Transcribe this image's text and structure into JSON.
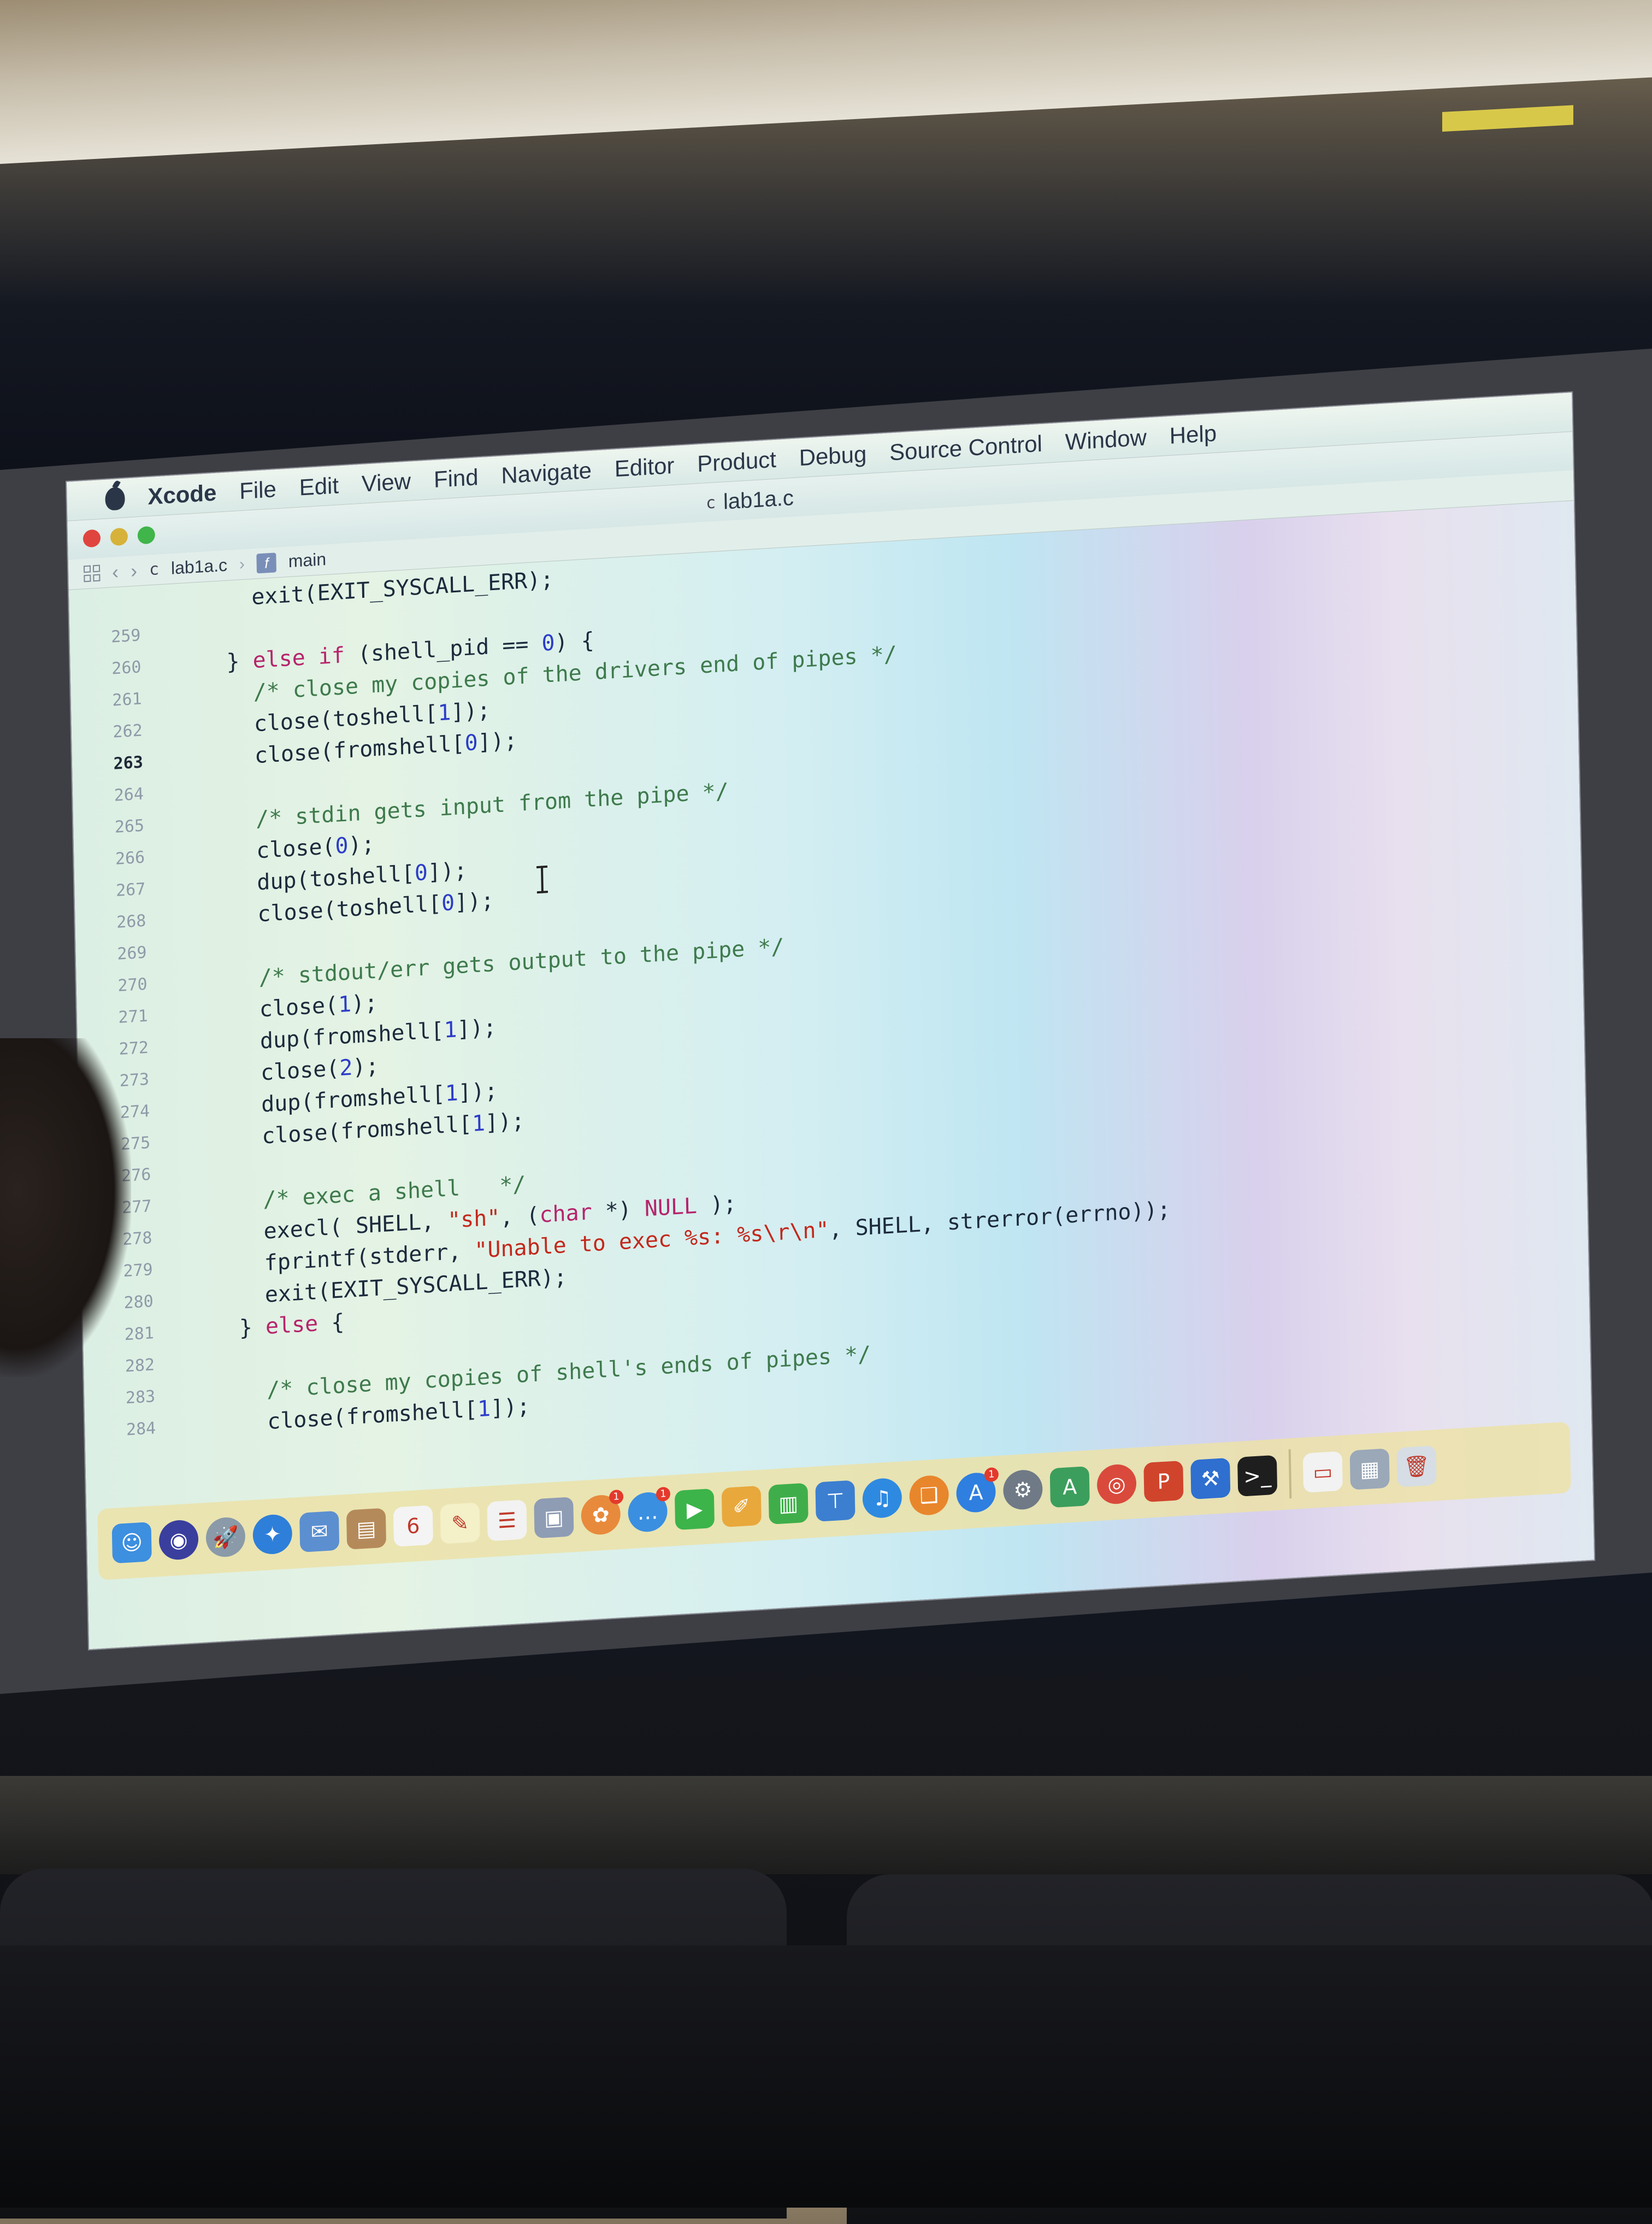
{
  "menubar": {
    "app_name": "Xcode",
    "items": [
      "File",
      "Edit",
      "View",
      "Find",
      "Navigate",
      "Editor",
      "Product",
      "Debug",
      "Source Control",
      "Window",
      "Help"
    ]
  },
  "window": {
    "title": "lab1a.c"
  },
  "jumpbar": {
    "file": "lab1a.c",
    "symbol": "main",
    "symbol_icon_letter": "f"
  },
  "editor": {
    "current_line": "263",
    "lines": [
      {
        "n": "",
        "parts": [
          {
            "t": "      exit(EXIT_SYSCALL_ERR);",
            "c": ""
          }
        ]
      },
      {
        "n": "259",
        "parts": []
      },
      {
        "n": "260",
        "parts": [
          {
            "t": "    } ",
            "c": ""
          },
          {
            "t": "else if",
            "c": "kw"
          },
          {
            "t": " (shell_pid == ",
            "c": ""
          },
          {
            "t": "0",
            "c": "num"
          },
          {
            "t": ") {",
            "c": ""
          }
        ]
      },
      {
        "n": "261",
        "parts": [
          {
            "t": "      ",
            "c": ""
          },
          {
            "t": "/* close my copies of the drivers end of pipes */",
            "c": "cm"
          }
        ]
      },
      {
        "n": "262",
        "parts": [
          {
            "t": "      close(toshell[",
            "c": ""
          },
          {
            "t": "1",
            "c": "num"
          },
          {
            "t": "]);",
            "c": ""
          }
        ]
      },
      {
        "n": "263",
        "parts": [
          {
            "t": "      close(fromshell[",
            "c": ""
          },
          {
            "t": "0",
            "c": "num"
          },
          {
            "t": "]);",
            "c": ""
          }
        ]
      },
      {
        "n": "264",
        "parts": []
      },
      {
        "n": "265",
        "parts": [
          {
            "t": "      ",
            "c": ""
          },
          {
            "t": "/* stdin gets input from the pipe */",
            "c": "cm"
          }
        ]
      },
      {
        "n": "266",
        "parts": [
          {
            "t": "      close(",
            "c": ""
          },
          {
            "t": "0",
            "c": "num"
          },
          {
            "t": ");",
            "c": ""
          }
        ]
      },
      {
        "n": "267",
        "parts": [
          {
            "t": "      dup(toshell[",
            "c": ""
          },
          {
            "t": "0",
            "c": "num"
          },
          {
            "t": "]);",
            "c": ""
          }
        ]
      },
      {
        "n": "268",
        "parts": [
          {
            "t": "      close(toshell[",
            "c": ""
          },
          {
            "t": "0",
            "c": "num"
          },
          {
            "t": "]);",
            "c": ""
          }
        ]
      },
      {
        "n": "269",
        "parts": []
      },
      {
        "n": "270",
        "parts": [
          {
            "t": "      ",
            "c": ""
          },
          {
            "t": "/* stdout/err gets output to the pipe */",
            "c": "cm"
          }
        ]
      },
      {
        "n": "271",
        "parts": [
          {
            "t": "      close(",
            "c": ""
          },
          {
            "t": "1",
            "c": "num"
          },
          {
            "t": ");",
            "c": ""
          }
        ]
      },
      {
        "n": "272",
        "parts": [
          {
            "t": "      dup(fromshell[",
            "c": ""
          },
          {
            "t": "1",
            "c": "num"
          },
          {
            "t": "]);",
            "c": ""
          }
        ]
      },
      {
        "n": "273",
        "parts": [
          {
            "t": "      close(",
            "c": ""
          },
          {
            "t": "2",
            "c": "num"
          },
          {
            "t": ");",
            "c": ""
          }
        ]
      },
      {
        "n": "274",
        "parts": [
          {
            "t": "      dup(fromshell[",
            "c": ""
          },
          {
            "t": "1",
            "c": "num"
          },
          {
            "t": "]);",
            "c": ""
          }
        ]
      },
      {
        "n": "275",
        "parts": [
          {
            "t": "      close(fromshell[",
            "c": ""
          },
          {
            "t": "1",
            "c": "num"
          },
          {
            "t": "]);",
            "c": ""
          }
        ]
      },
      {
        "n": "276",
        "parts": []
      },
      {
        "n": "277",
        "parts": [
          {
            "t": "      ",
            "c": ""
          },
          {
            "t": "/* exec a shell   */",
            "c": "cm"
          }
        ]
      },
      {
        "n": "278",
        "parts": [
          {
            "t": "      execl( SHELL, ",
            "c": ""
          },
          {
            "t": "\"sh\"",
            "c": "str"
          },
          {
            "t": ", (",
            "c": ""
          },
          {
            "t": "char",
            "c": "kw"
          },
          {
            "t": " *) ",
            "c": ""
          },
          {
            "t": "NULL",
            "c": "kw"
          },
          {
            "t": " );",
            "c": ""
          }
        ]
      },
      {
        "n": "279",
        "parts": [
          {
            "t": "      fprintf(stderr, ",
            "c": ""
          },
          {
            "t": "\"Unable to exec %s: %s\\r\\n\"",
            "c": "str"
          },
          {
            "t": ", SHELL, strerror(errno));",
            "c": ""
          }
        ]
      },
      {
        "n": "280",
        "parts": [
          {
            "t": "      exit(EXIT_SYSCALL_ERR);",
            "c": ""
          }
        ]
      },
      {
        "n": "281",
        "parts": [
          {
            "t": "    } ",
            "c": ""
          },
          {
            "t": "else",
            "c": "kw"
          },
          {
            "t": " {",
            "c": ""
          }
        ]
      },
      {
        "n": "282",
        "parts": []
      },
      {
        "n": "283",
        "parts": [
          {
            "t": "      ",
            "c": ""
          },
          {
            "t": "/* close my copies of shell's ends of pipes */",
            "c": "cm"
          }
        ]
      },
      {
        "n": "284",
        "parts": [
          {
            "t": "      close(fromshell[",
            "c": ""
          },
          {
            "t": "1",
            "c": "num"
          },
          {
            "t": "]);",
            "c": ""
          }
        ]
      }
    ]
  },
  "dock": {
    "items": [
      {
        "name": "finder-icon",
        "color": "#3d8fe0",
        "glyph": "☺"
      },
      {
        "name": "siri-icon",
        "color": "#3a3f9e",
        "glyph": "◉",
        "round": true
      },
      {
        "name": "launchpad-icon",
        "color": "#8a9aa8",
        "glyph": "🚀",
        "round": true
      },
      {
        "name": "safari-icon",
        "color": "#2e7fd9",
        "glyph": "✦",
        "round": true
      },
      {
        "name": "mail-icon",
        "color": "#5c8fd0",
        "glyph": "✉"
      },
      {
        "name": "contacts-icon",
        "color": "#b58a5a",
        "glyph": "▤"
      },
      {
        "name": "calendar-icon",
        "color": "#f4f4f4",
        "glyph": "6"
      },
      {
        "name": "notes-icon",
        "color": "#f4f0c8",
        "glyph": "✎"
      },
      {
        "name": "reminders-icon",
        "color": "#f2f2f2",
        "glyph": "☰"
      },
      {
        "name": "preview-icon",
        "color": "#8e9cb4",
        "glyph": "▣"
      },
      {
        "name": "photos-icon",
        "color": "#e88a3c",
        "glyph": "✿",
        "round": true,
        "badge": "1"
      },
      {
        "name": "messages-icon",
        "color": "#3a8fe0",
        "glyph": "…",
        "round": true,
        "badge": "1"
      },
      {
        "name": "facetime-icon",
        "color": "#3cb44a",
        "glyph": "▶"
      },
      {
        "name": "pages-icon",
        "color": "#e8a83c",
        "glyph": "✐"
      },
      {
        "name": "numbers-icon",
        "color": "#3fae4a",
        "glyph": "▥"
      },
      {
        "name": "keynote-icon",
        "color": "#3c7fd0",
        "glyph": "⊤"
      },
      {
        "name": "itunes-icon",
        "color": "#2e8ae0",
        "glyph": "♫",
        "round": true
      },
      {
        "name": "ibooks-icon",
        "color": "#e8862c",
        "glyph": "❑",
        "round": true
      },
      {
        "name": "app-store-icon",
        "color": "#2e7fe0",
        "glyph": "A",
        "round": true,
        "badge": "1"
      },
      {
        "name": "system-preferences-icon",
        "color": "#6f7a86",
        "glyph": "⚙",
        "round": true
      },
      {
        "name": "android-studio-icon",
        "color": "#3c9e5c",
        "glyph": "A"
      },
      {
        "name": "chrome-icon",
        "color": "#d94a3c",
        "glyph": "◎",
        "round": true
      },
      {
        "name": "powerpoint-icon",
        "color": "#d0442c",
        "glyph": "P"
      },
      {
        "name": "xcode-icon",
        "color": "#2e6fd0",
        "glyph": "⚒"
      },
      {
        "name": "terminal-icon",
        "color": "#1e1e1e",
        "glyph": ">_"
      },
      {
        "name": "document-icon",
        "color": "#f2f2f2",
        "glyph": "▭",
        "after_separator": true
      },
      {
        "name": "downloads-folder-icon",
        "color": "#9aa8b8",
        "glyph": "▦"
      },
      {
        "name": "trash-icon",
        "color": "#d6dde4",
        "glyph": "🗑"
      }
    ]
  }
}
